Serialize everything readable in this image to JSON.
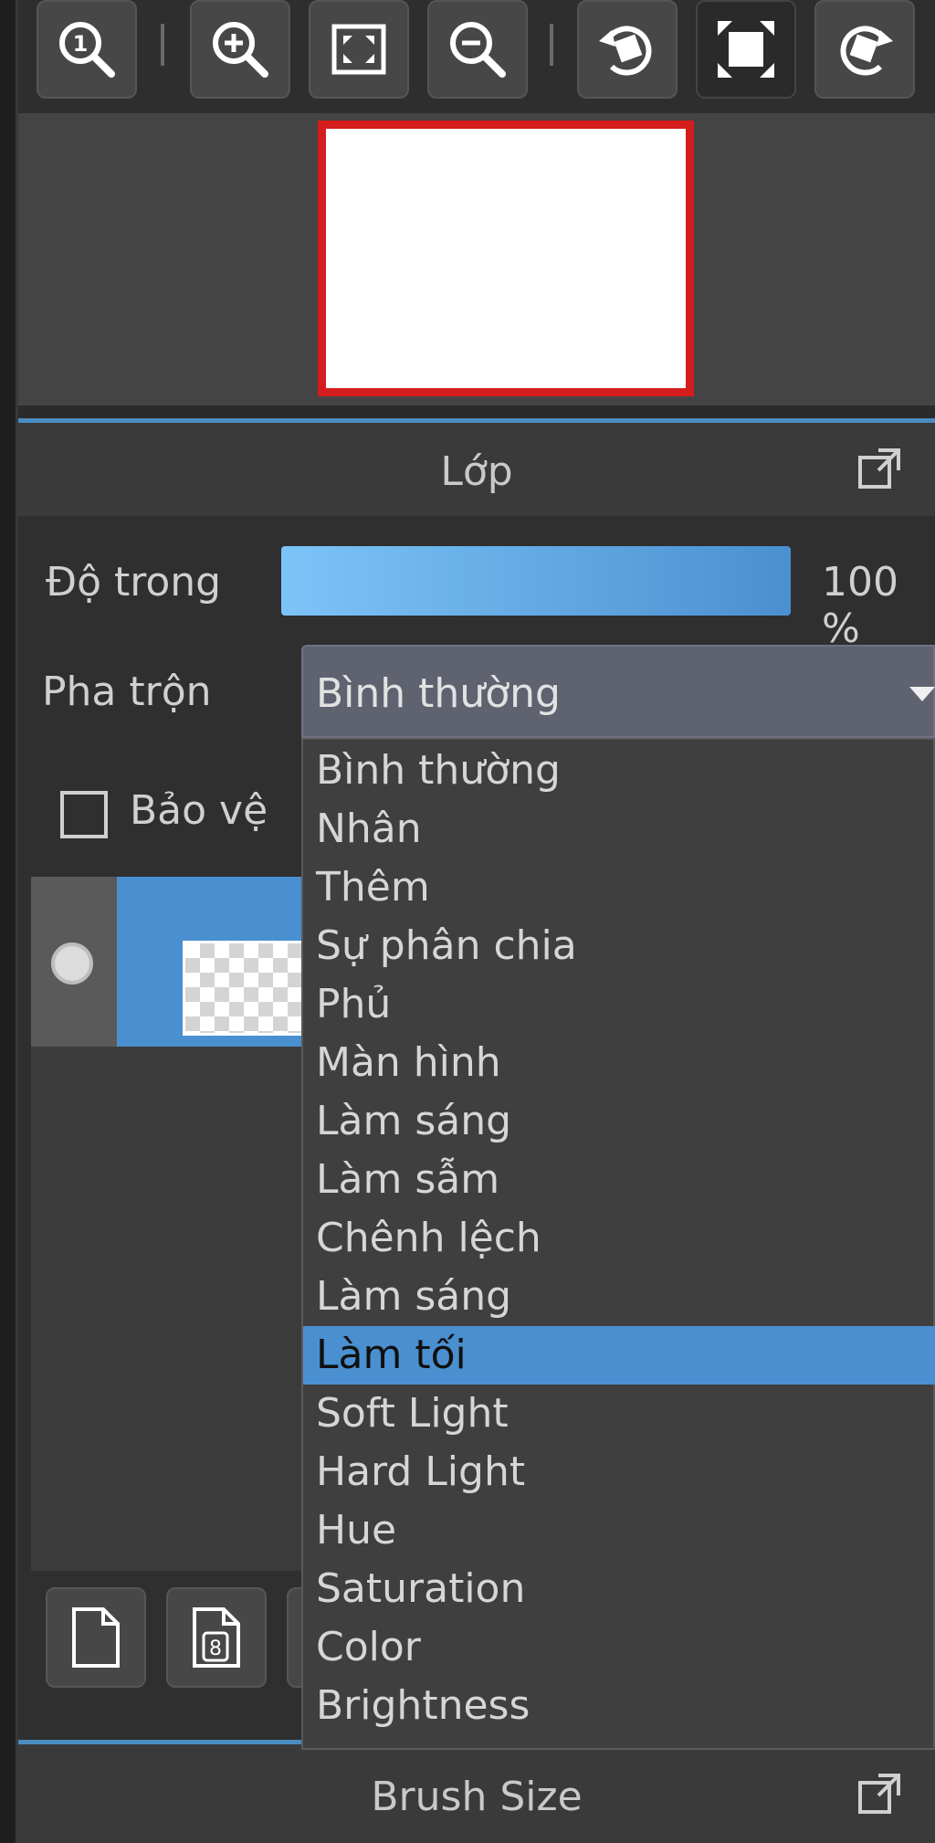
{
  "toolbar": {
    "buttons": [
      {
        "name": "zoom-actual-size-icon"
      },
      {
        "name": "zoom-in-icon"
      },
      {
        "name": "fit-window-icon"
      },
      {
        "name": "zoom-out-icon"
      },
      {
        "name": "rotate-left-icon"
      },
      {
        "name": "fullscreen-icon"
      },
      {
        "name": "rotate-right-icon"
      }
    ]
  },
  "layer_panel": {
    "title": "Lớp",
    "opacity_label": "Độ trong",
    "opacity_value": 1.0,
    "opacity_text": "100 %",
    "blend_label": "Pha trộn",
    "blend_selected": "Bình thường",
    "protect_label": "Bảo vệ",
    "protect_checked": false
  },
  "blend_modes": {
    "options": [
      "Bình thường",
      "Nhân",
      "Thêm",
      "Sự phân chia",
      "Phủ",
      "Màn hình",
      "Làm sáng",
      "Làm sẫm",
      "Chênh lệch",
      "Làm sáng",
      "Làm tối",
      "Soft Light",
      "Hard Light",
      "Hue",
      "Saturation",
      "Color",
      "Brightness"
    ],
    "highlighted_index": 10
  },
  "brush_panel": {
    "title": "Brush Size"
  },
  "colors": {
    "accent": "#4a90d0",
    "frame": "#d41d1d"
  }
}
